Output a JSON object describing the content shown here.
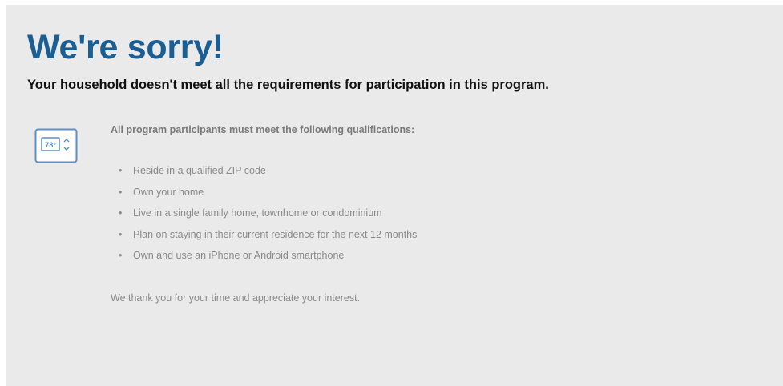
{
  "heading": {
    "title": "We're sorry!",
    "subtitle": "Your household doesn't meet all the requirements for participation in this program."
  },
  "icon": {
    "name": "thermostat-icon",
    "display_text": "78°",
    "color": "#5b8fc9"
  },
  "requirements": {
    "intro": "All program participants must meet the following qualifications:",
    "items": [
      "Reside in a qualified ZIP code",
      "Own your home",
      "Live in a single family home, townhome or condominium",
      "Plan on staying in their current residence for the next 12 months",
      "Own and use an iPhone or Android smartphone"
    ]
  },
  "closing": {
    "text": "We thank you for your time and appreciate your interest."
  },
  "colors": {
    "title": "#1a5e93",
    "panel_background": "#eaeaea",
    "body_text": "#8a8a8a"
  }
}
